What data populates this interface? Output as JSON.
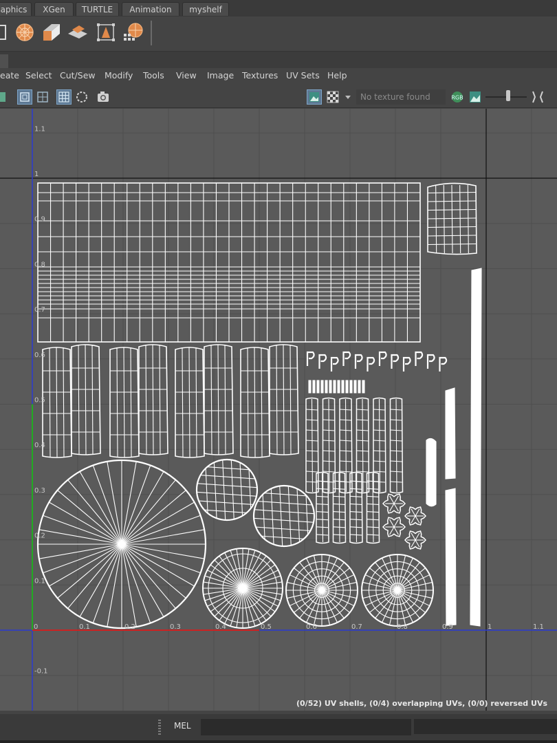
{
  "shelf_tabs": [
    {
      "label": "aphics"
    },
    {
      "label": "XGen"
    },
    {
      "label": "TURTLE"
    },
    {
      "label": "Animation"
    },
    {
      "label": "myshelf"
    }
  ],
  "shelf_icons": [
    {
      "icon": "polygon-icon"
    },
    {
      "icon": "sphere-uv-icon"
    },
    {
      "icon": "cube-uv-icon"
    },
    {
      "icon": "plane-uv-icon"
    },
    {
      "icon": "bounding-box-icon"
    },
    {
      "icon": "sphere-grid-icon"
    }
  ],
  "menu": [
    "eate",
    "Select",
    "Cut/Sew",
    "Modify",
    "Tools",
    "View",
    "Image",
    "Textures",
    "UV Sets",
    "Help"
  ],
  "toolbar": {
    "texture_field": "No texture found",
    "exposure_slider_level": 0.5
  },
  "colors": {
    "u_axis": "#cc2222",
    "v_axis": "#22aa22",
    "grid_line": "#4f4f4f",
    "wireframe": "#ffffff",
    "background": "#5a5a5a"
  },
  "uv_editor": {
    "tick_labels": {
      "u": [
        "0",
        "0.1",
        "0.2",
        "0.3",
        "0.4",
        "0.5",
        "0.6",
        "0.7",
        "0.8",
        "0.9",
        "1",
        "1.1"
      ],
      "v": [
        "1.1",
        "1",
        "0.9",
        "0.8",
        "0.7",
        "0.6",
        "0.5",
        "0.4",
        "0.3",
        "0.2",
        "0.1",
        "-0.1"
      ]
    },
    "status": "(0/52) UV shells, (0/4) overlapping UVs, (0/0) reversed UVs"
  },
  "command_line": {
    "mel_label": "MEL",
    "input_value": ""
  }
}
